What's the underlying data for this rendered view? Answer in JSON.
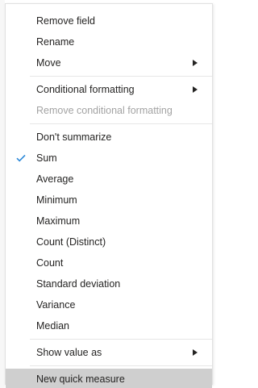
{
  "menu": {
    "group1": [
      {
        "label": "Remove field"
      },
      {
        "label": "Rename"
      },
      {
        "label": "Move"
      }
    ],
    "group2": [
      {
        "label": "Conditional formatting"
      },
      {
        "label": "Remove conditional formatting"
      }
    ],
    "group3": [
      {
        "label": "Don't summarize"
      },
      {
        "label": "Sum"
      },
      {
        "label": "Average"
      },
      {
        "label": "Minimum"
      },
      {
        "label": "Maximum"
      },
      {
        "label": "Count (Distinct)"
      },
      {
        "label": "Count"
      },
      {
        "label": "Standard deviation"
      },
      {
        "label": "Variance"
      },
      {
        "label": "Median"
      }
    ],
    "group4": [
      {
        "label": "Show value as"
      }
    ],
    "group5": [
      {
        "label": "New quick measure"
      }
    ]
  },
  "colors": {
    "check": "#2b88d8",
    "text": "#252423",
    "disabled_text": "#a3a3a3",
    "highlight": "#cfcfcf"
  },
  "icons": {
    "submenu": "caret-right-icon",
    "selected": "checkmark-icon"
  },
  "state": {
    "selected_aggregation": "Sum",
    "hovered_item": "New quick measure"
  }
}
